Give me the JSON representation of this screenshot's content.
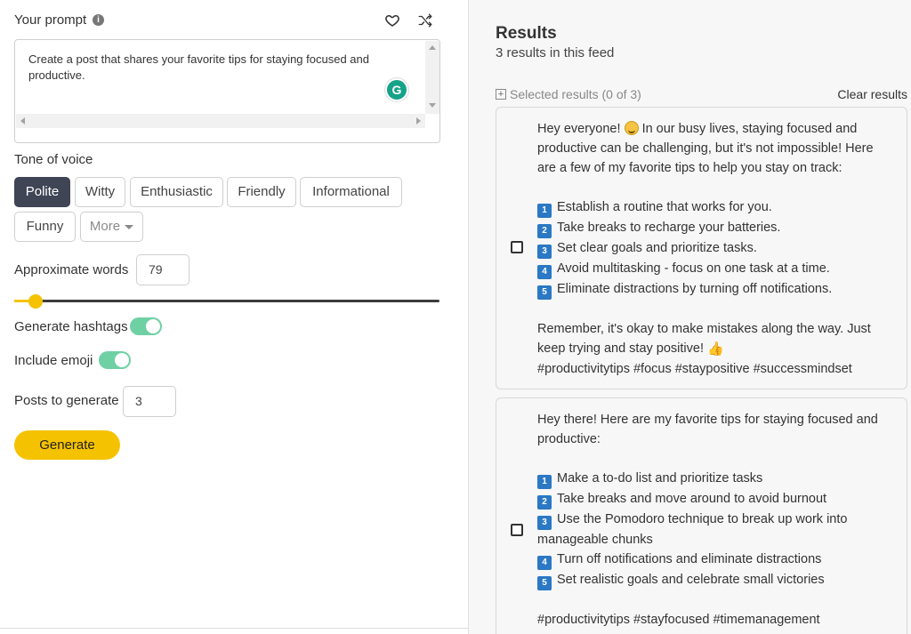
{
  "left": {
    "prompt_label": "Your prompt",
    "prompt_text": "Create a post that shares your favorite tips for staying focused and productive.",
    "tone_label": "Tone of voice",
    "tones": [
      "Polite",
      "Witty",
      "Enthusiastic",
      "Friendly",
      "Informational",
      "Funny"
    ],
    "tone_selected": "Polite",
    "more_label": "More",
    "approx_words_label": "Approximate words",
    "approx_words_value": "79",
    "slider_fraction": 0.05,
    "hashtags_label": "Generate hashtags",
    "hashtags_on": true,
    "emoji_label": "Include emoji",
    "emoji_on": true,
    "posts_label": "Posts to generate",
    "posts_value": "3",
    "generate_label": "Generate"
  },
  "right": {
    "title": "Results",
    "subtitle": "3 results in this feed",
    "selected_label": "Selected results (0 of 3)",
    "clear_label": "Clear results",
    "cards": [
      {
        "intro_a": "Hey everyone!",
        "intro_b": "In our busy lives, staying focused and productive can be challenging, but it's not impossible! Here are a few of my favorite tips to help you stay on track:",
        "tips": [
          {
            "n": "1",
            "text": "Establish a routine that works for you."
          },
          {
            "n": "2",
            "text": "Take breaks to recharge your batteries."
          },
          {
            "n": "3",
            "text": "Set clear goals and prioritize tasks."
          },
          {
            "n": "4",
            "text": "Avoid multitasking - focus on one task at a time."
          },
          {
            "n": "5",
            "text": "Eliminate distractions by turning off notifications."
          }
        ],
        "outro": "Remember, it's okay to make mistakes along the way. Just keep trying and stay positive!",
        "hashtags": "#productivitytips #focus #staypositive #successmindset"
      },
      {
        "intro": "Hey there! Here are my favorite tips for staying focused and productive:",
        "tips": [
          {
            "n": "1",
            "text": "Make a to-do list and prioritize tasks"
          },
          {
            "n": "2",
            "text": "Take breaks and move around to avoid burnout"
          },
          {
            "n": "3",
            "text": "Use the Pomodoro technique to break up work into manageable chunks"
          },
          {
            "n": "4",
            "text": "Turn off notifications and eliminate distractions"
          },
          {
            "n": "5",
            "text": "Set realistic goals and celebrate small victories"
          }
        ],
        "hashtags": "#productivitytips #stayfocused #timemanagement"
      }
    ]
  },
  "icons": {
    "info": "info-icon",
    "favorite": "heart-icon",
    "shuffle": "shuffle-icon",
    "grammarly": "grammarly-icon",
    "expand": "plus-box-icon"
  },
  "colors": {
    "accent_yellow": "#f5c200",
    "chip_active": "#3f4555",
    "toggle_on": "#6fd0a4",
    "number_badge": "#2b78c4"
  }
}
